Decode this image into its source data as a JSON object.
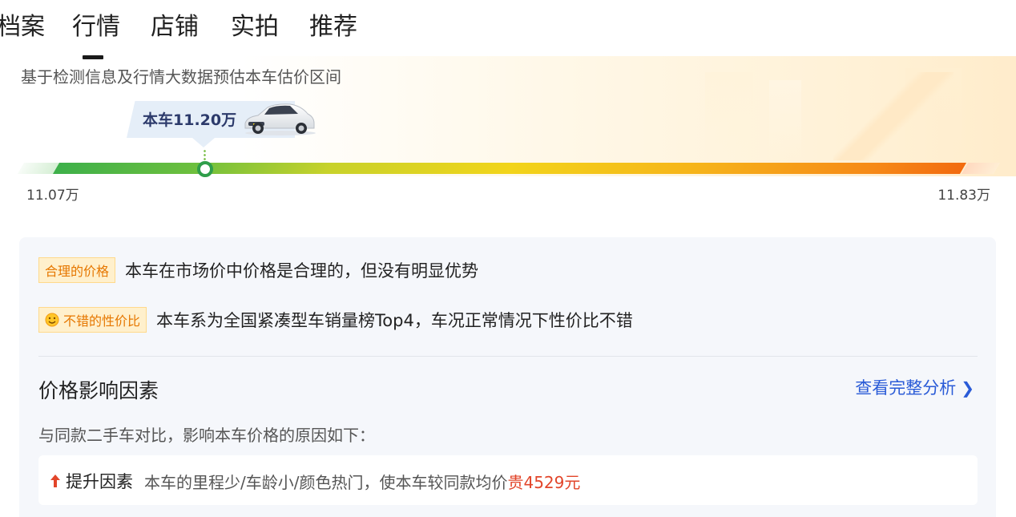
{
  "tabs": [
    {
      "label": "档案"
    },
    {
      "label": "行情",
      "active": true
    },
    {
      "label": "店铺"
    },
    {
      "label": "实拍"
    },
    {
      "label": "推荐"
    }
  ],
  "estimate": {
    "subtitle": "基于检测信息及行情大数据预估本车估价区间",
    "car_price_label": "本车11.20万",
    "range_min": "11.07万",
    "range_max": "11.83万",
    "car_value_wan": 11.2,
    "min_wan": 11.07,
    "max_wan": 11.83
  },
  "verdicts": [
    {
      "tag": "合理的价格",
      "text": "本车在市场价中价格是合理的，但没有明显优势",
      "icon": null
    },
    {
      "tag": "不错的性价比",
      "text": "本车系为全国紧凑型车销量榜Top4，车况正常情况下性价比不错",
      "icon": "smile-icon"
    }
  ],
  "factors": {
    "title": "价格影响因素",
    "link": "查看完整分析",
    "description": "与同款二手车对比，影响本车价格的原因如下：",
    "item": {
      "label": "提升因素",
      "desc": "本车的里程少/车龄小/颜色热门，使本车较同款均价",
      "emphasis": "贵4529元"
    }
  },
  "colors": {
    "accent_blue": "#2a5bd7",
    "tag_orange": "#e67700",
    "price_red": "#e2452a",
    "marker_green": "#2f9e4a"
  }
}
